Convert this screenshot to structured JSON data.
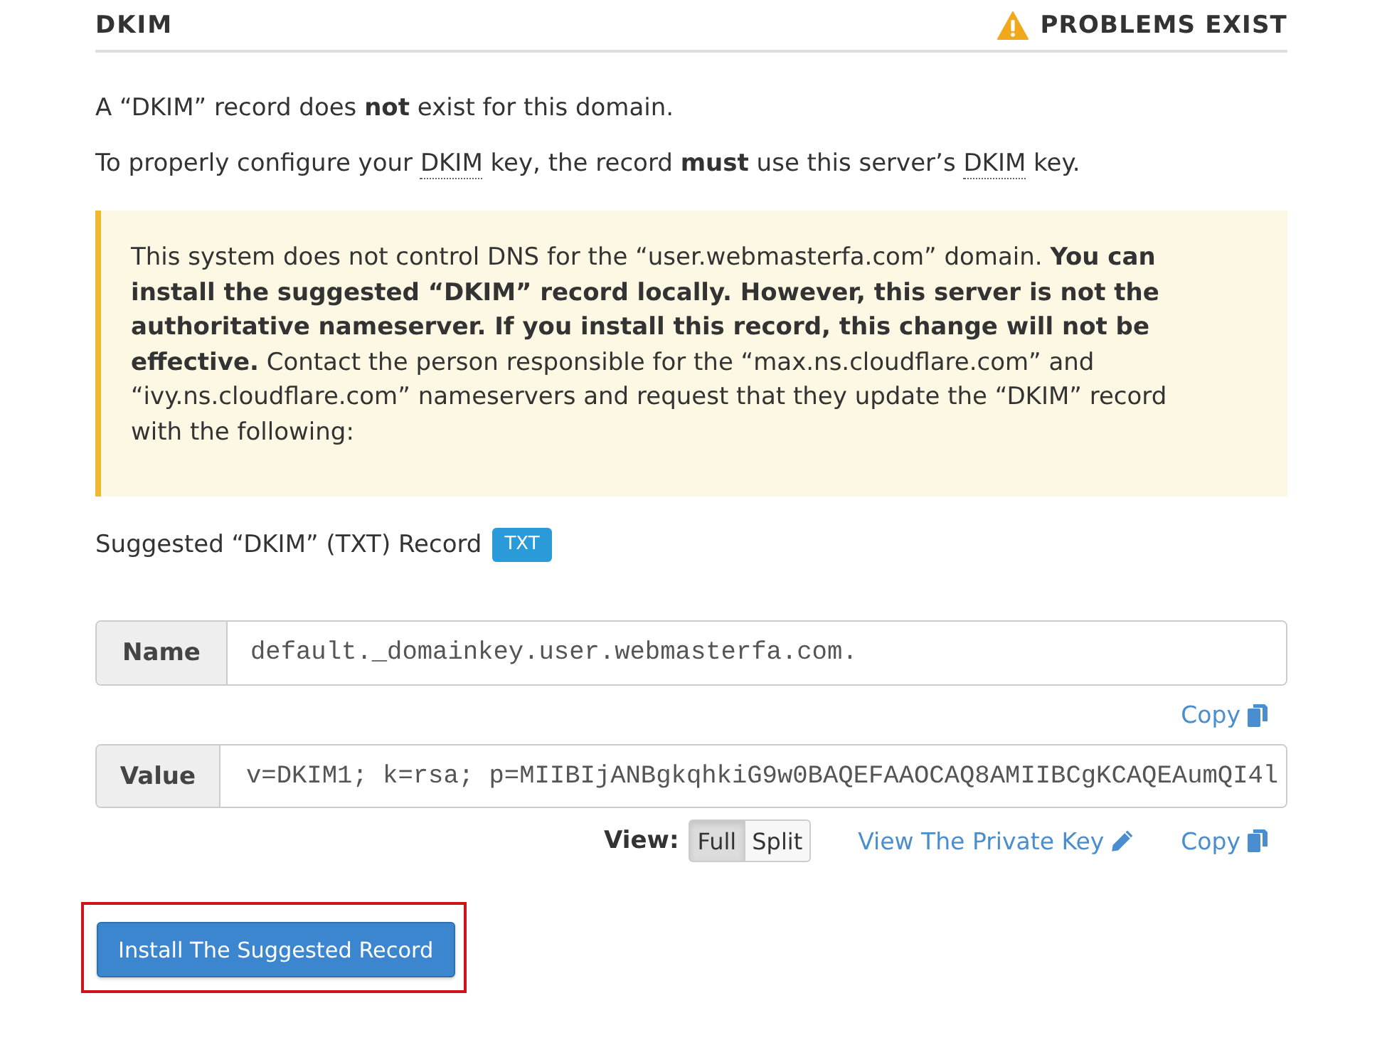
{
  "section": {
    "title": "DKIM",
    "status": {
      "kind": "warning",
      "label": "PROBLEMS EXIST"
    }
  },
  "messages": [
    {
      "segments": [
        {
          "kind": "text",
          "text": "A “DKIM” record does **not** exist for this domain."
        }
      ]
    },
    {
      "segments": [
        {
          "kind": "text",
          "text": "To properly configure your "
        },
        {
          "kind": "abbr",
          "text": "DKIM"
        },
        {
          "kind": "text",
          "text": " key, the record **must** use this server’s "
        },
        {
          "kind": "abbr",
          "text": "DKIM"
        },
        {
          "kind": "text",
          "text": " key."
        }
      ]
    }
  ],
  "alert": {
    "kind": "warning",
    "text": "This system does not control DNS for the “user.webmasterfa.com” domain. **You can install the suggested “DKIM” record locally. However, this server is not the authoritative nameserver. If you install this record, this change will not be effective.** Contact the person responsible for the “max.ns.cloudflare.com” and “ivy.ns.cloudflare.com” nameservers and request that they update the “DKIM” record with the following:"
  },
  "suggested_record": {
    "title": "Suggested “DKIM” (TXT) Record",
    "badge": "TXT"
  },
  "fields": [
    {
      "label": "Name",
      "value": "default._domainkey.user.webmasterfa.com.",
      "actions": [
        {
          "kind": "copy",
          "label": "Copy"
        }
      ]
    },
    {
      "label": "Value",
      "value": "v=DKIM1; k=rsa; p=MIIBIjANBgkqhkiG9w0BAQEFAAOCAQ8AMIIBCgKCAQEAumQI4l",
      "view": {
        "label": "View:",
        "options": [
          {
            "label": "Full",
            "selected": true
          },
          {
            "label": "Split",
            "selected": false
          }
        ]
      },
      "actions": [
        {
          "kind": "private_key",
          "label": "View The Private Key"
        },
        {
          "kind": "copy",
          "label": "Copy"
        }
      ]
    }
  ],
  "install_button": {
    "label": "Install The Suggested Record",
    "highlighted": true
  }
}
